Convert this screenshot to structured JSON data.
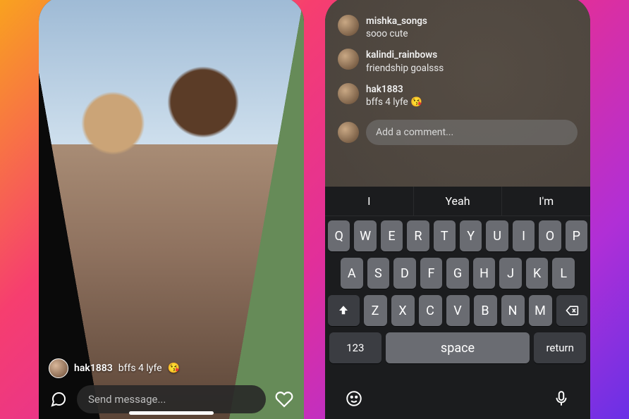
{
  "left": {
    "story": {
      "username": "hak1883",
      "caption": "bffs 4 lyfe",
      "emoji": "😘"
    },
    "message_placeholder": "Send message...",
    "icons": {
      "comment": "comment-bubble-icon",
      "like": "heart-icon"
    }
  },
  "right": {
    "comments": [
      {
        "username": "mishka_songs",
        "text": "sooo cute"
      },
      {
        "username": "kalindi_rainbows",
        "text": "friendship goalsss"
      },
      {
        "username": "hak1883",
        "text": "bffs 4 lyfe 😘"
      }
    ],
    "comment_placeholder": "Add a comment...",
    "keyboard": {
      "suggestions": [
        "I",
        "Yeah",
        "I'm"
      ],
      "rows": [
        [
          "Q",
          "W",
          "E",
          "R",
          "T",
          "Y",
          "U",
          "I",
          "O",
          "P"
        ],
        [
          "A",
          "S",
          "D",
          "F",
          "G",
          "H",
          "J",
          "K",
          "L"
        ],
        [
          "Z",
          "X",
          "C",
          "V",
          "B",
          "N",
          "M"
        ]
      ],
      "shift": "⇧",
      "backspace": "⌫",
      "numbers": "123",
      "space": "space",
      "return": "return"
    }
  }
}
